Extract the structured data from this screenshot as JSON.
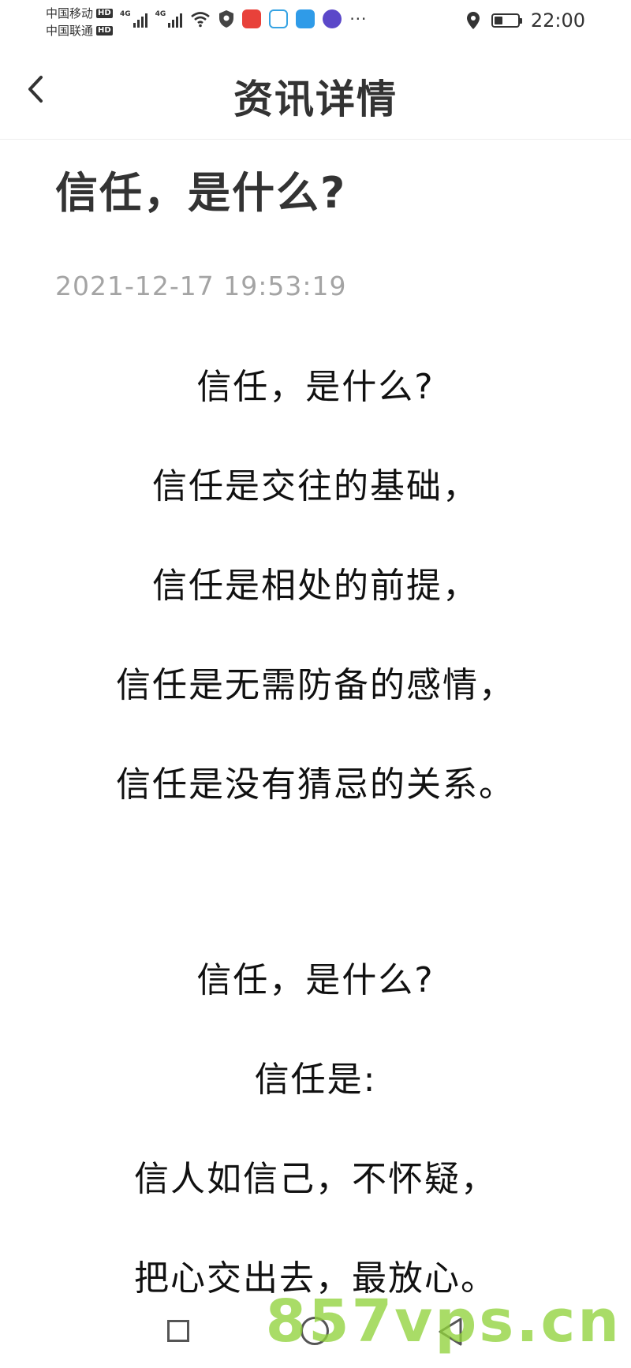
{
  "status_bar": {
    "carrier1": "中国移动",
    "carrier2": "中国联通",
    "hd": "HD",
    "network": "4G",
    "time": "22:00",
    "icons": [
      "signal-icon",
      "wifi-icon",
      "shield-icon",
      "book-app-icon",
      "cloud-app-icon",
      "app-icon",
      "face-app-icon",
      "more-icon",
      "location-icon",
      "battery-icon"
    ]
  },
  "header": {
    "title": "资讯详情"
  },
  "article": {
    "title": "信任，是什么?",
    "time": "2021-12-17 19:53:19",
    "lines": [
      "信任，是什么?",
      "信任是交往的基础，",
      "信任是相处的前提，",
      "信任是无需防备的感情，",
      "信任是没有猜忌的关系。",
      "信任，是什么?",
      "信任是:",
      "信人如信己，不怀疑，",
      "把心交出去，最放心。"
    ]
  },
  "watermark": "857vps.cn",
  "colors": {
    "text": "#111111",
    "header_text": "#333333",
    "timestamp": "#a4a4a4",
    "watermark": "#91d23c"
  }
}
